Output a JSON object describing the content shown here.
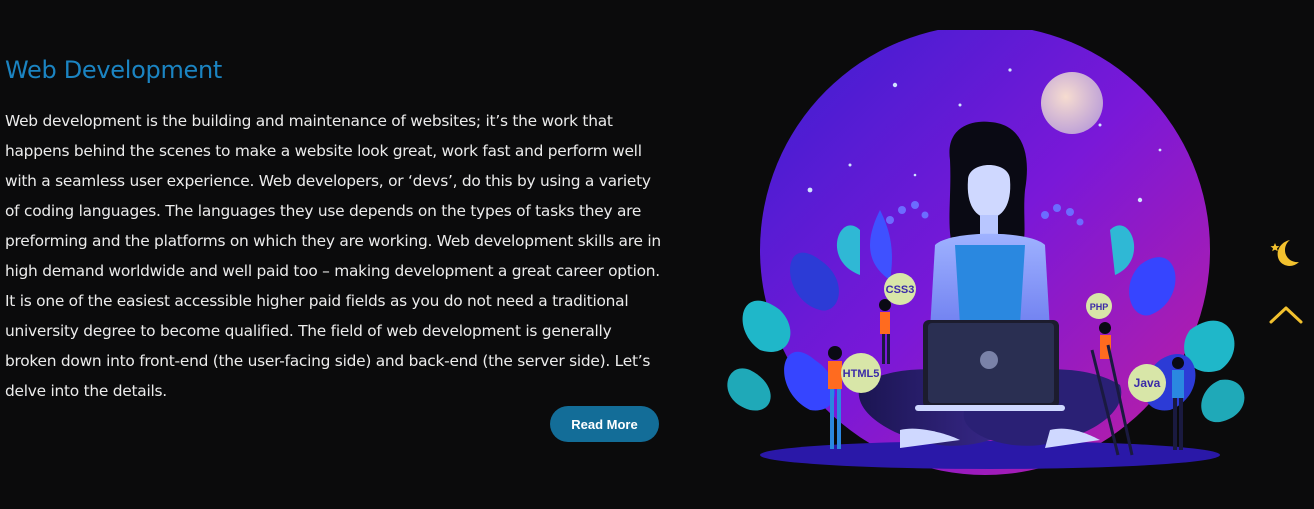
{
  "section": {
    "title": "Web Development",
    "body": "Web development is the building and maintenance of websites; it’s the work that happens behind the scenes to make a website look great, work fast and perform well with a seamless user experience. Web developers, or ‘devs’, do this by using a variety of coding languages. The languages they use depends on the types of tasks they are preforming and the platforms on which they are working. Web development skills are in high demand worldwide and well paid too – making development a great career option. It is one of the easiest accessible higher paid fields as you do not need a traditional university degree to become qualified. The field of web development is generally broken down into front-end (the user-facing side) and back-end (the server side). Let’s delve into the details.",
    "read_more_label": "Read More"
  },
  "illustration": {
    "badges": {
      "css": "CSS3",
      "php": "PHP",
      "html": "HTML5",
      "java": "Java"
    }
  },
  "controls": {
    "theme_toggle_icon": "moon-star-icon",
    "scroll_top_icon": "chevron-up-icon"
  },
  "colors": {
    "background": "#0b0b0c",
    "title": "#1b84c2",
    "button": "#136d98",
    "accent_gold": "#f2c12e",
    "circle_purple": "#6b1fd9"
  }
}
